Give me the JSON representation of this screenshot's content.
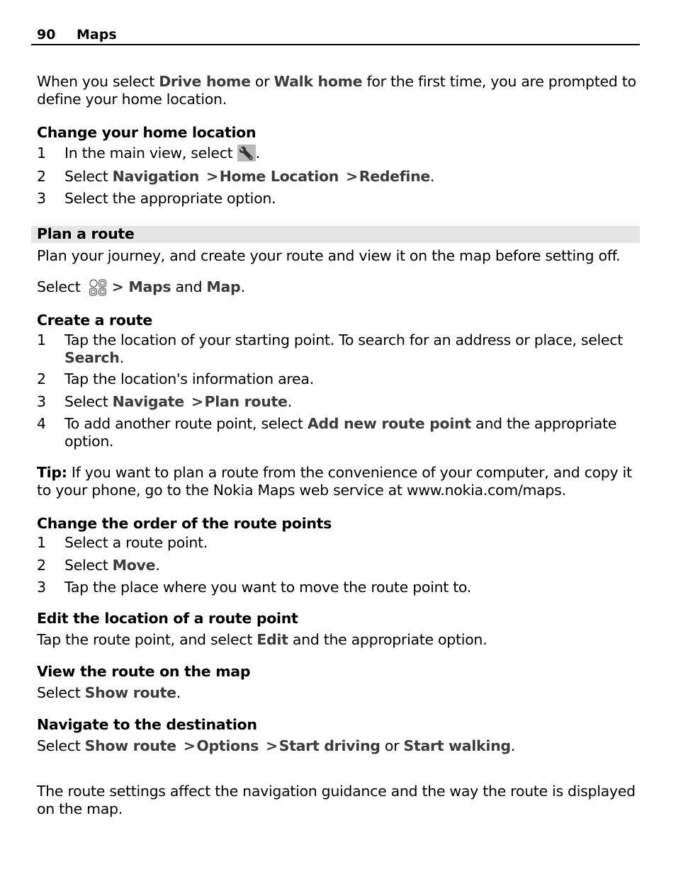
{
  "header": {
    "page_number": "90",
    "chapter": "Maps"
  },
  "intro": {
    "pre": "When you select ",
    "term1": "Drive home",
    "mid": " or ",
    "term2": "Walk home",
    "post": " for the first time, you are prompted to define your home location."
  },
  "change_home": {
    "heading": "Change your home location",
    "steps": [
      {
        "n": "1",
        "pre": "In the main view, select ",
        "icon": "wrench-icon",
        "post": "."
      },
      {
        "n": "2",
        "pre": "Select ",
        "terms": [
          "Navigation",
          "Home Location",
          "Redefine"
        ],
        "sep": " > ",
        "post": "."
      },
      {
        "n": "3",
        "text": "Select the appropriate option."
      }
    ]
  },
  "plan_route": {
    "section_title": "Plan a route",
    "description": "Plan your journey, and create your route and view it on the map before setting off.",
    "select_line": {
      "pre": "Select ",
      "icon": "apps-menu-icon",
      "sep": "> ",
      "term1": "Maps",
      "mid": " and ",
      "term2": "Map",
      "post": "."
    }
  },
  "create_route": {
    "heading": "Create a route",
    "steps": [
      {
        "n": "1",
        "text": "Tap the location of your starting point. To search for an address or place, select ",
        "term": "Search",
        "post": "."
      },
      {
        "n": "2",
        "text": "Tap the location's information area."
      },
      {
        "n": "3",
        "pre": "Select ",
        "term1": "Navigate",
        "sep": " > ",
        "term2": "Plan route",
        "post": "."
      },
      {
        "n": "4",
        "pre": "To add another route point, select ",
        "term": "Add new route point",
        "post": " and the appropriate option."
      }
    ]
  },
  "tip": {
    "label": "Tip:",
    "text": " If you want to plan a route from the convenience of your computer, and copy it to your phone, go to the Nokia Maps web service at www.nokia.com/maps."
  },
  "change_order": {
    "heading": "Change the order of the route points",
    "steps": [
      {
        "n": "1",
        "text": "Select a route point."
      },
      {
        "n": "2",
        "pre": "Select ",
        "term": "Move",
        "post": "."
      },
      {
        "n": "3",
        "text": "Tap the place where you want to move the route point to."
      }
    ]
  },
  "edit_location": {
    "heading": "Edit the location of a route point",
    "pre": "Tap the route point, and select ",
    "term": "Edit",
    "post": " and the appropriate option."
  },
  "view_route": {
    "heading": "View the route on the map",
    "pre": "Select ",
    "term": "Show route",
    "post": "."
  },
  "navigate": {
    "heading": "Navigate to the destination",
    "pre": "Select ",
    "terms": [
      "Show route",
      "Options",
      "Start driving"
    ],
    "sep": " > ",
    "mid": " or ",
    "last_term": "Start walking",
    "post": "."
  },
  "route_settings": {
    "text": "The route settings affect the navigation guidance and the way the route is displayed on the map."
  }
}
